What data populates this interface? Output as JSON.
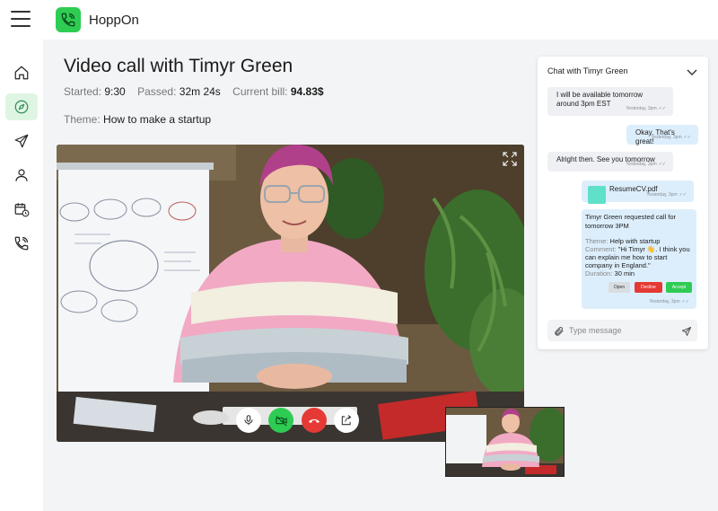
{
  "app": {
    "name": "HoppOn"
  },
  "sidebar": {
    "items": [
      {
        "icon": "home-icon"
      },
      {
        "icon": "compass-icon",
        "active": true
      },
      {
        "icon": "send-icon"
      },
      {
        "icon": "user-icon"
      },
      {
        "icon": "calendar-clock-icon"
      },
      {
        "icon": "phone-call-icon"
      }
    ]
  },
  "call": {
    "title": "Video call with Timyr Green",
    "started_label": "Started:",
    "started_value": "9:30",
    "passed_label": "Passed:",
    "passed_value": "32m 24s",
    "bill_label": "Current bill:",
    "bill_value": "94.83$",
    "theme_label": "Theme:",
    "theme_value": "How to make a startup"
  },
  "controls": [
    "microphone-icon",
    "video-camera-icon",
    "hang-up-icon",
    "share-screen-icon"
  ],
  "chat": {
    "title": "Chat with Timyr Green",
    "messages": [
      {
        "text": "I will be available tomorrow around 3pm EST",
        "time": "Yesterday, 3pm"
      },
      {
        "text": "Okay. That's great!",
        "time": "Yesterday, 3pm"
      },
      {
        "text": "Alright then. See you tomorrow",
        "time": "Yesterday, 3pm"
      },
      {
        "file": "ResumeCV.pdf",
        "time": "Yesterday, 3pm"
      }
    ],
    "request": {
      "title": "Timyr Green requested call for tomorrow 3PM",
      "theme_label": "Theme:",
      "theme_value": "Help with startup",
      "comment_label": "Comment:",
      "comment_value": "\"Hi Timyr 👋. I think you can explain me how to start company in England.\"",
      "duration_label": "Duration:",
      "duration_value": "30 min",
      "open_label": "Open",
      "decline_label": "Decline",
      "accept_label": "Accept",
      "time": "Yesterday, 3pm"
    },
    "input_placeholder": "Type message"
  },
  "colors": {
    "brand": "#2ecc52",
    "hangup": "#e53935",
    "decline": "#e53935",
    "accept": "#2ecc52"
  }
}
